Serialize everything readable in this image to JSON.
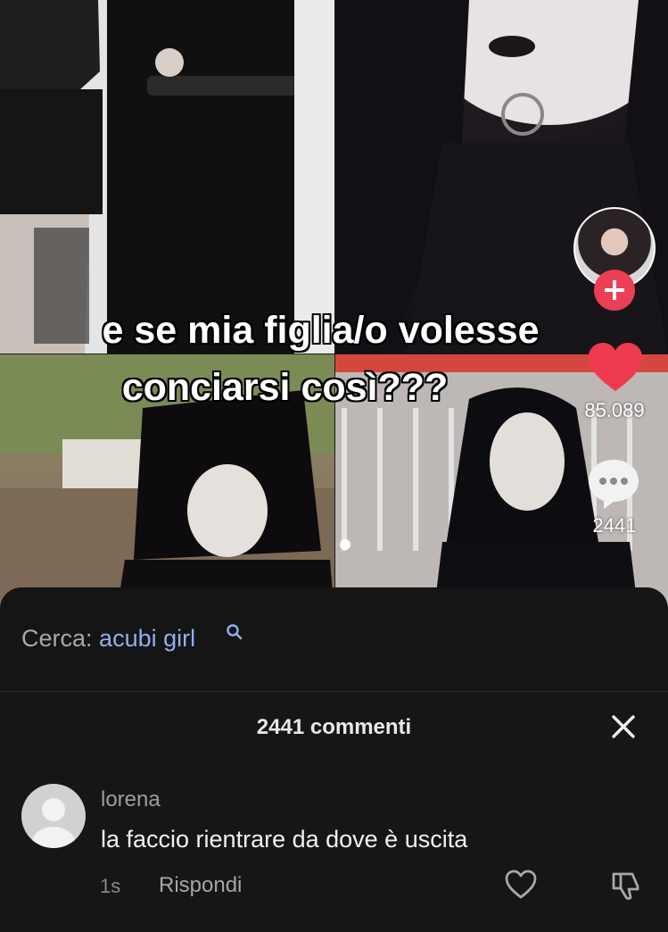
{
  "video": {
    "caption_line1": "e se mia figlia/o volesse",
    "caption_line2": "conciarsi così???",
    "likes": "85.089",
    "comments": "2441"
  },
  "search": {
    "prefix": "Cerca:",
    "term": "acubi girl",
    "term_color": "#8fb0ea"
  },
  "comments_sheet": {
    "title": "2441 commenti",
    "items": [
      {
        "username": "lorena",
        "text": "la faccio rientrare da dove è uscita",
        "time": "1s",
        "reply_label": "Rispondi"
      }
    ]
  },
  "colors": {
    "accent": "#ea3f55",
    "background": "#161616"
  },
  "icons": [
    "plus-icon",
    "heart-icon",
    "comment-bubble-icon",
    "search-icon",
    "close-icon",
    "heart-outline-icon",
    "dislike-icon"
  ]
}
